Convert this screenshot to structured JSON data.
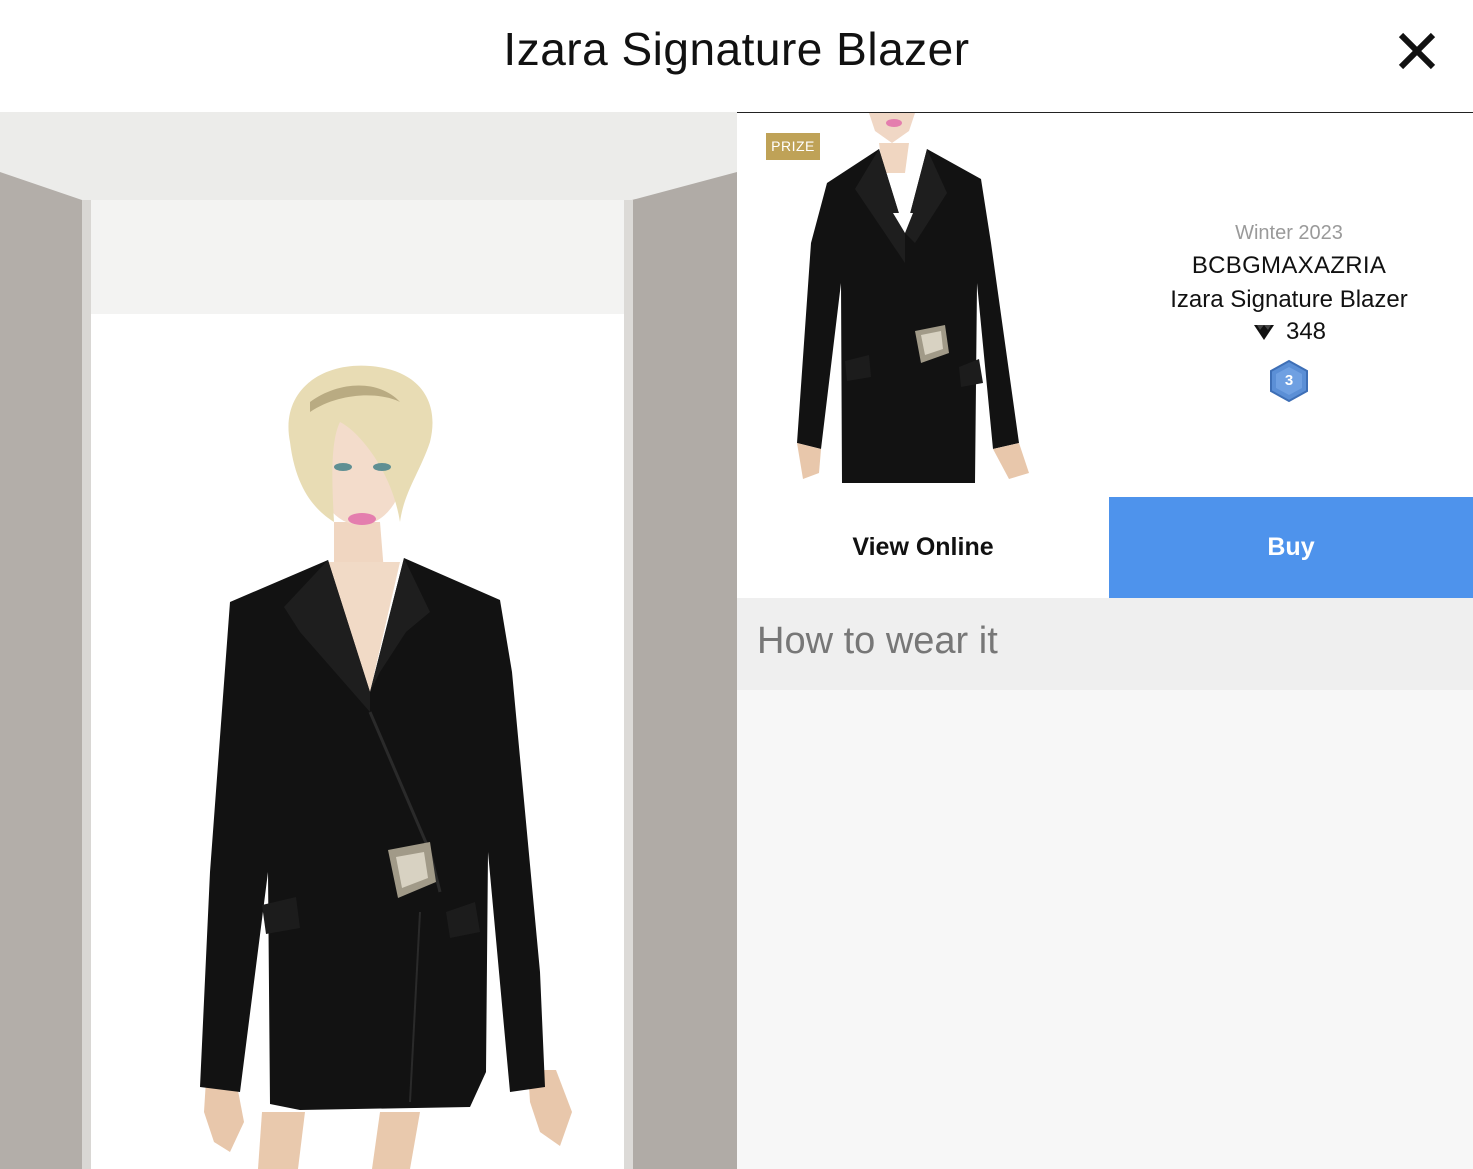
{
  "header": {
    "title": "Izara Signature Blazer",
    "close_icon": "close-icon"
  },
  "product": {
    "badge": "PRIZE",
    "season": "Winter 2023",
    "brand": "BCBGMAXAZRIA",
    "name": "Izara Signature Blazer",
    "price": "348",
    "currency_icon": "diamond-icon",
    "level": "3"
  },
  "actions": {
    "view_online": "View Online",
    "buy": "Buy"
  },
  "section": {
    "how_to_wear": "How to wear it"
  },
  "colors": {
    "buy_button": "#4e93ec",
    "prize_badge": "#bfa257",
    "level_badge": "#5b8fd6"
  }
}
